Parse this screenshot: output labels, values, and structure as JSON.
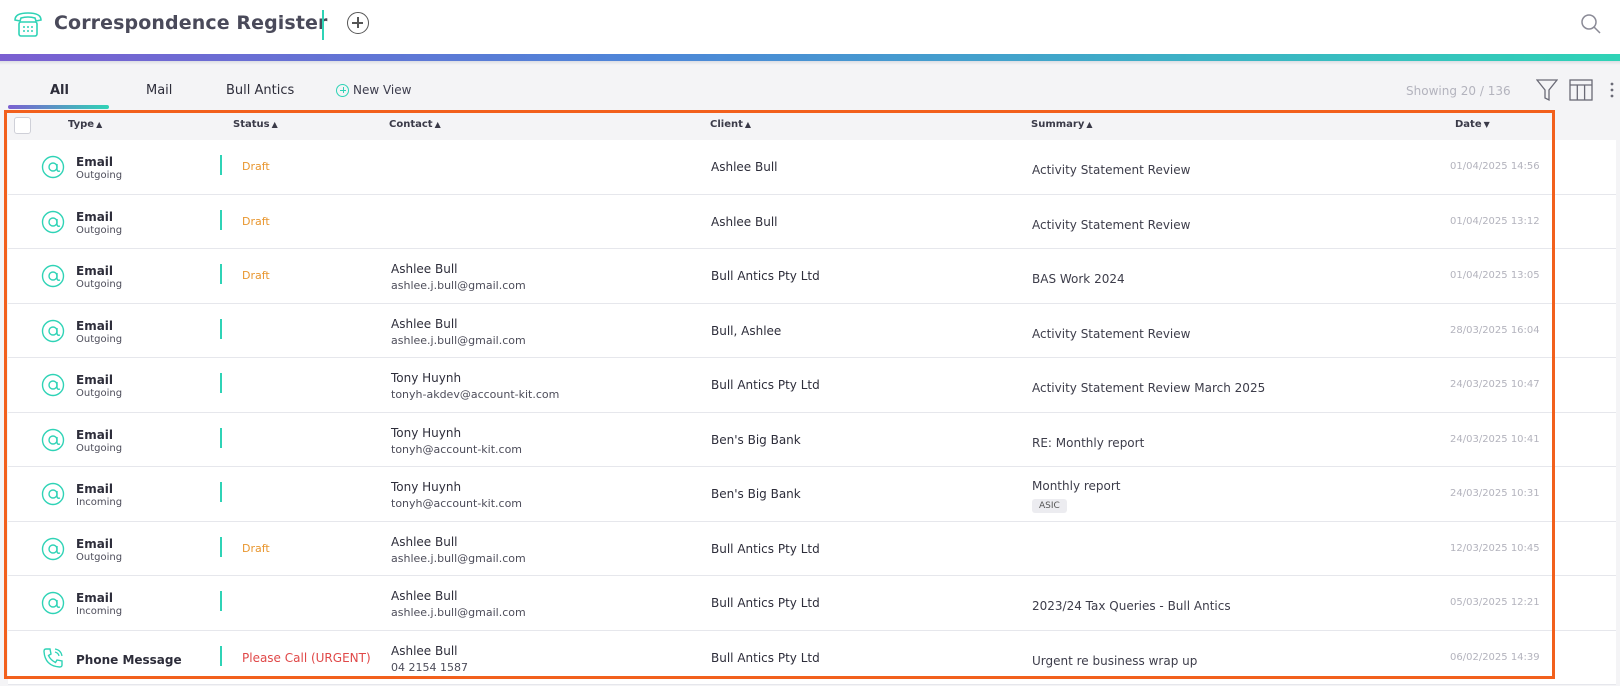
{
  "header": {
    "title": "Correspondence Register",
    "icons": {
      "app": "telephone-icon",
      "add": "add-circle-icon",
      "search": "search-icon"
    }
  },
  "toolbar": {
    "tabs": [
      {
        "label": "All",
        "active": true
      },
      {
        "label": "Mail",
        "active": false
      },
      {
        "label": "Bull Antics",
        "active": false
      }
    ],
    "new_view_label": "New View",
    "showing": "Showing 20 / 136"
  },
  "table": {
    "columns": {
      "type": "Type",
      "status": "Status",
      "contact": "Contact",
      "client": "Client",
      "summary": "Summary",
      "date": "Date"
    },
    "rows": [
      {
        "icon": "at-icon",
        "type": "Email",
        "direction": "Outgoing",
        "status": "Draft",
        "status_kind": "draft",
        "contact_name": "",
        "contact_detail": "",
        "client": "Ashlee Bull",
        "summary": "Activity Statement Review",
        "tag": "",
        "date": "01/04/2025 14:56"
      },
      {
        "icon": "at-icon",
        "type": "Email",
        "direction": "Outgoing",
        "status": "Draft",
        "status_kind": "draft",
        "contact_name": "",
        "contact_detail": "",
        "client": "Ashlee Bull",
        "summary": "Activity Statement Review",
        "tag": "",
        "date": "01/04/2025 13:12"
      },
      {
        "icon": "at-icon",
        "type": "Email",
        "direction": "Outgoing",
        "status": "Draft",
        "status_kind": "draft",
        "contact_name": "Ashlee Bull",
        "contact_detail": "ashlee.j.bull@gmail.com",
        "client": "Bull Antics Pty Ltd",
        "summary": "BAS Work 2024",
        "tag": "",
        "date": "01/04/2025 13:05"
      },
      {
        "icon": "at-icon",
        "type": "Email",
        "direction": "Outgoing",
        "status": "",
        "status_kind": "",
        "contact_name": "Ashlee Bull",
        "contact_detail": "ashlee.j.bull@gmail.com",
        "client": "Bull, Ashlee",
        "summary": "Activity Statement Review",
        "tag": "",
        "date": "28/03/2025 16:04"
      },
      {
        "icon": "at-icon",
        "type": "Email",
        "direction": "Outgoing",
        "status": "",
        "status_kind": "",
        "contact_name": "Tony Huynh",
        "contact_detail": "tonyh-akdev@account-kit.com",
        "client": "Bull Antics Pty Ltd",
        "summary": "Activity Statement Review March 2025",
        "tag": "",
        "date": "24/03/2025 10:47"
      },
      {
        "icon": "at-icon",
        "type": "Email",
        "direction": "Outgoing",
        "status": "",
        "status_kind": "",
        "contact_name": "Tony Huynh",
        "contact_detail": "tonyh@account-kit.com",
        "client": "Ben's Big Bank",
        "summary": "RE: Monthly report",
        "tag": "",
        "date": "24/03/2025 10:41"
      },
      {
        "icon": "at-icon",
        "type": "Email",
        "direction": "Incoming",
        "status": "",
        "status_kind": "",
        "contact_name": "Tony Huynh",
        "contact_detail": "tonyh@account-kit.com",
        "client": "Ben's Big Bank",
        "summary": "Monthly report",
        "tag": "ASIC",
        "date": "24/03/2025 10:31"
      },
      {
        "icon": "at-icon",
        "type": "Email",
        "direction": "Outgoing",
        "status": "Draft",
        "status_kind": "draft",
        "contact_name": "Ashlee Bull",
        "contact_detail": "ashlee.j.bull@gmail.com",
        "client": "Bull Antics Pty Ltd",
        "summary": "",
        "tag": "",
        "date": "12/03/2025 10:45"
      },
      {
        "icon": "at-icon",
        "type": "Email",
        "direction": "Incoming",
        "status": "",
        "status_kind": "",
        "contact_name": "Ashlee Bull",
        "contact_detail": "ashlee.j.bull@gmail.com",
        "client": "Bull Antics Pty Ltd",
        "summary": "2023/24 Tax Queries - Bull Antics",
        "tag": "",
        "date": "05/03/2025 12:21"
      },
      {
        "icon": "phone-icon",
        "type": "Phone Message",
        "direction": "",
        "status": "Please Call (URGENT)",
        "status_kind": "urgent",
        "contact_name": "Ashlee Bull",
        "contact_detail": "04 2154 1587",
        "client": "Bull Antics Pty Ltd",
        "summary": "Urgent re business wrap up",
        "tag": "",
        "date": "06/02/2025 14:39"
      }
    ]
  },
  "colors": {
    "accent": "#2fd3b6",
    "brand_purple": "#7b5fd1",
    "draft": "#e8962e",
    "urgent": "#e04848",
    "highlight": "#f2601c"
  }
}
